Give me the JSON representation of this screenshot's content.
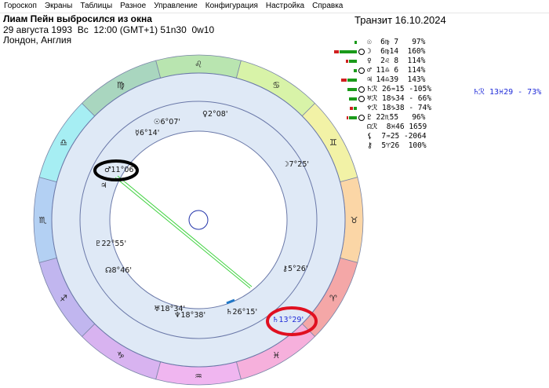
{
  "menu": [
    "Гороскоп",
    "Экраны",
    "Таблицы",
    "Разное",
    "Управление",
    "Конфигурация",
    "Настройка",
    "Справка"
  ],
  "header": {
    "title": "Лиам Пейн выбросился из окна",
    "line1": "29 августа 1993  Вс  12:00 (GMT+1) 51n30  0w10",
    "line2": "Лондон, Англия",
    "transit": "Транзит 16.10.2024"
  },
  "planets": [
    {
      "glyph": "☉",
      "text": " 6♍ 7   97%",
      "circle": false,
      "bars": [
        {
          "w": 3,
          "c": "#1a9a1a"
        }
      ]
    },
    {
      "glyph": "☽",
      "text": " 6♍14  160%",
      "circle": true,
      "bars": [
        {
          "w": 22,
          "c": "#1a9a1a"
        },
        {
          "w": 6,
          "c": "#d02020"
        }
      ]
    },
    {
      "glyph": "♀",
      "text": " 2♌ 8  114%",
      "circle": false,
      "bars": [
        {
          "w": 10,
          "c": "#1a9a1a"
        },
        {
          "w": 3,
          "c": "#d02020"
        }
      ]
    },
    {
      "glyph": "♂",
      "text": "11♎ 6  114%",
      "circle": true,
      "bars": [
        {
          "w": 4,
          "c": "#1a9a1a"
        }
      ]
    },
    {
      "glyph": "♃",
      "text": "14♎39  143%",
      "circle": false,
      "bars": [
        {
          "w": 12,
          "c": "#1a9a1a"
        },
        {
          "w": 7,
          "c": "#d02020"
        }
      ]
    },
    {
      "glyph": "♄ℛ",
      "text": "26♒15 -105%",
      "circle": true,
      "bars": [
        {
          "w": 12,
          "c": "#1a9a1a"
        }
      ]
    },
    {
      "glyph": "♅ℛ",
      "text": "18♑34 - 66%",
      "circle": true,
      "bars": [
        {
          "w": 10,
          "c": "#1a9a1a"
        }
      ]
    },
    {
      "glyph": "♆ℛ",
      "text": "18♑38 - 74%",
      "circle": false,
      "bars": [
        {
          "w": 4,
          "c": "#1a9a1a"
        },
        {
          "w": 4,
          "c": "#d02020"
        }
      ]
    },
    {
      "glyph": "♇",
      "text": "22♏55   96%",
      "circle": true,
      "bars": [
        {
          "w": 10,
          "c": "#1a9a1a"
        },
        {
          "w": 2,
          "c": "#d02020"
        }
      ]
    },
    {
      "glyph": "☊ℛ",
      "text": " 8♓46 1659",
      "circle": false,
      "bars": []
    },
    {
      "glyph": "⚸",
      "text": " 7♒25 -2064",
      "circle": false,
      "bars": []
    },
    {
      "glyph": "⚷",
      "text": " 5♈26  100%",
      "circle": false,
      "bars": []
    }
  ],
  "transit_side": "♄ℛ 13♓29 - 73%",
  "chart": {
    "zodiac": [
      {
        "sign": "♌",
        "color": "#b9e5b0"
      },
      {
        "sign": "♋",
        "color": "#d8f3a8"
      },
      {
        "sign": "♊",
        "color": "#f2f2a6"
      },
      {
        "sign": "♉",
        "color": "#fbd6a6"
      },
      {
        "sign": "♈",
        "color": "#f4a7a7"
      },
      {
        "sign": "♓",
        "color": "#f6b0dc"
      },
      {
        "sign": "♒",
        "color": "#f0b6f0"
      },
      {
        "sign": "♑",
        "color": "#d8b3f0"
      },
      {
        "sign": "♐",
        "color": "#c1b6ef"
      },
      {
        "sign": "♏",
        "color": "#b3d0f3"
      },
      {
        "sign": "♎",
        "color": "#a6eef3"
      },
      {
        "sign": "♍",
        "color": "#a9d6bf"
      }
    ],
    "inner_labels": [
      {
        "name": "sun-label",
        "text": "☉6°07'"
      },
      {
        "name": "venus-label",
        "text": "♀2°08'"
      },
      {
        "name": "mercury-label",
        "text": "☿6°14'"
      },
      {
        "name": "moon-label",
        "text": "☽7°25'"
      },
      {
        "name": "mars-label",
        "text": "♂11°06'"
      },
      {
        "name": "pluto-label",
        "text": "♇22°55'"
      },
      {
        "name": "node-label",
        "text": "☊8°46'"
      },
      {
        "name": "chiron-label",
        "text": "⚷5°26'"
      },
      {
        "name": "uranus-label",
        "text": "♅18°34'"
      },
      {
        "name": "neptune-label",
        "text": "♆18°38'"
      },
      {
        "name": "saturn-label",
        "text": "♄26°15'"
      },
      {
        "name": "transit-saturn-label",
        "text": "♄13°29'"
      },
      {
        "name": "jupiter-mark",
        "text": "♃"
      }
    ]
  }
}
